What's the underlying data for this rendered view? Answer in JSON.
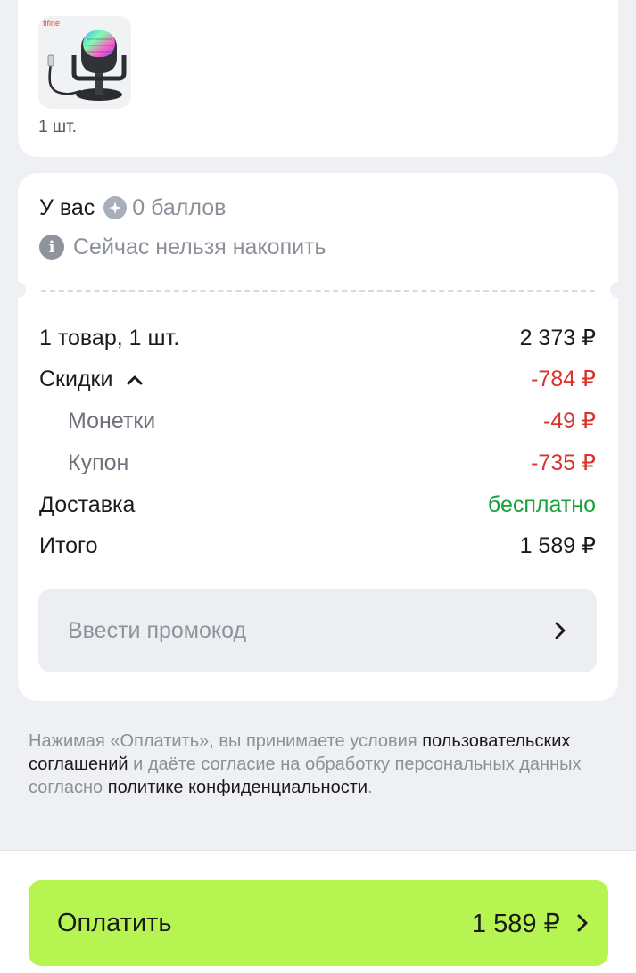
{
  "product": {
    "brand": "fifine",
    "image": "microphone-product-image",
    "quantity": "1 шт."
  },
  "points": {
    "prefix": "У вас",
    "icon": "points-coin-icon",
    "value": "0 баллов",
    "info_icon": "info-icon",
    "info_text": "Сейчас нельзя накопить"
  },
  "summary": {
    "items_label": "1 товар, 1 шт.",
    "items_value": "2 373 ₽",
    "discounts_label": "Скидки",
    "discounts_value": "-784 ₽",
    "coins_label": "Монетки",
    "coins_value": "-49 ₽",
    "coupon_label": "Купон",
    "coupon_value": "-735 ₽",
    "delivery_label": "Доставка",
    "delivery_value": "бесплатно",
    "total_label": "Итого",
    "total_value": "1 589 ₽"
  },
  "promo": {
    "placeholder": "Ввести промокод"
  },
  "legal": {
    "part1": "Нажимая «Оплатить», вы принимаете условия ",
    "link1": "пользовательских соглашений",
    "part2": " и даёте согласие на обработку персональных данных согласно ",
    "link2": "политике конфиденциальности",
    "part3": "."
  },
  "pay_button": {
    "label": "Оплатить",
    "amount": "1 589 ₽"
  },
  "colors": {
    "accent": "#b6f551",
    "negative": "#d8342c",
    "positive": "#1aa13c",
    "background": "#eef0f3"
  }
}
